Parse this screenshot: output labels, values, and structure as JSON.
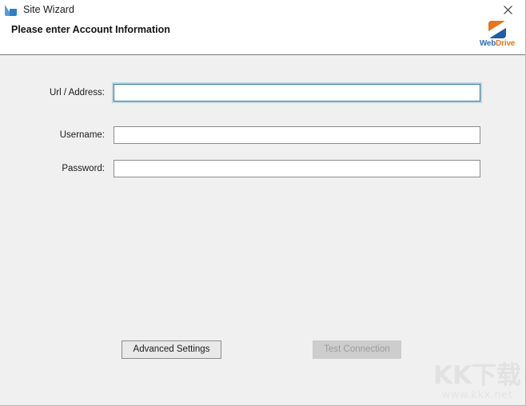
{
  "window": {
    "title": "Site Wizard",
    "app_icon": "site-wizard-icon",
    "close_label": "✕"
  },
  "header": {
    "heading": "Please enter Account Information",
    "brand": {
      "mark_icon": "webdrive-logo-icon",
      "name_part1": "Web",
      "name_part2": "Drive",
      "color_blue": "#2f6fb5",
      "color_orange": "#e8761a"
    }
  },
  "form": {
    "fields": [
      {
        "name": "url-address",
        "label": "Url / Address:",
        "value": "",
        "placeholder": "",
        "focused": true
      },
      {
        "name": "username",
        "label": "Username:",
        "value": "",
        "placeholder": "",
        "focused": false
      },
      {
        "name": "password",
        "label": "Password:",
        "value": "",
        "placeholder": "",
        "focused": false
      }
    ]
  },
  "buttons": {
    "advanced_settings": {
      "label": "Advanced Settings",
      "enabled": true
    },
    "test_connection": {
      "label": "Test Connection",
      "enabled": false
    }
  },
  "watermark": {
    "logo_text": "KK下载",
    "url_text": "www.kkx.net"
  },
  "colors": {
    "body_background": "#f0f0f0",
    "header_background": "#ffffff",
    "focus_border": "#3d7e95",
    "focus_halo": "#b9d3e0",
    "field_border": "#8c8c8c",
    "separator": "#7b7b7b",
    "disabled_button_bg": "#cdcdcd",
    "disabled_button_text": "#9b9b9b"
  }
}
